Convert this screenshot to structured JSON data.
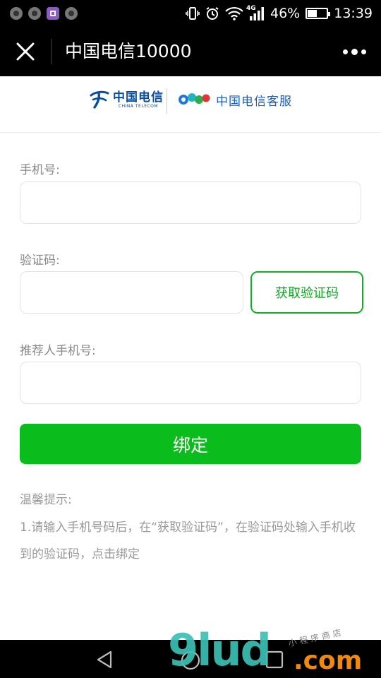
{
  "status_bar": {
    "battery_percent": "46%",
    "battery_level": 0.46,
    "network_type": "4G",
    "time": "13:39"
  },
  "nav": {
    "title": "中国电信10000"
  },
  "header": {
    "logo_cn": "中国电信",
    "logo_en": "CHINA TELECOM",
    "service_name": "中国电信客服"
  },
  "form": {
    "phone_label": "手机号:",
    "phone_value": "",
    "code_label": "验证码:",
    "code_value": "",
    "get_code_button": "获取验证码",
    "referrer_label": "推荐人手机号:",
    "referrer_value": "",
    "submit_button": "绑定"
  },
  "tips": {
    "title": "温馨提示:",
    "text": "1.请输入手机号码后，在“获取验证码”，在验证码处输入手机收到的验证码，点击绑定"
  },
  "watermark": {
    "brand": "9lud",
    "suffix": ".com",
    "tagline": "小程序商店"
  },
  "colors": {
    "primary_green": "#0bbd1c",
    "telecom_blue": "#0a4c9e"
  }
}
